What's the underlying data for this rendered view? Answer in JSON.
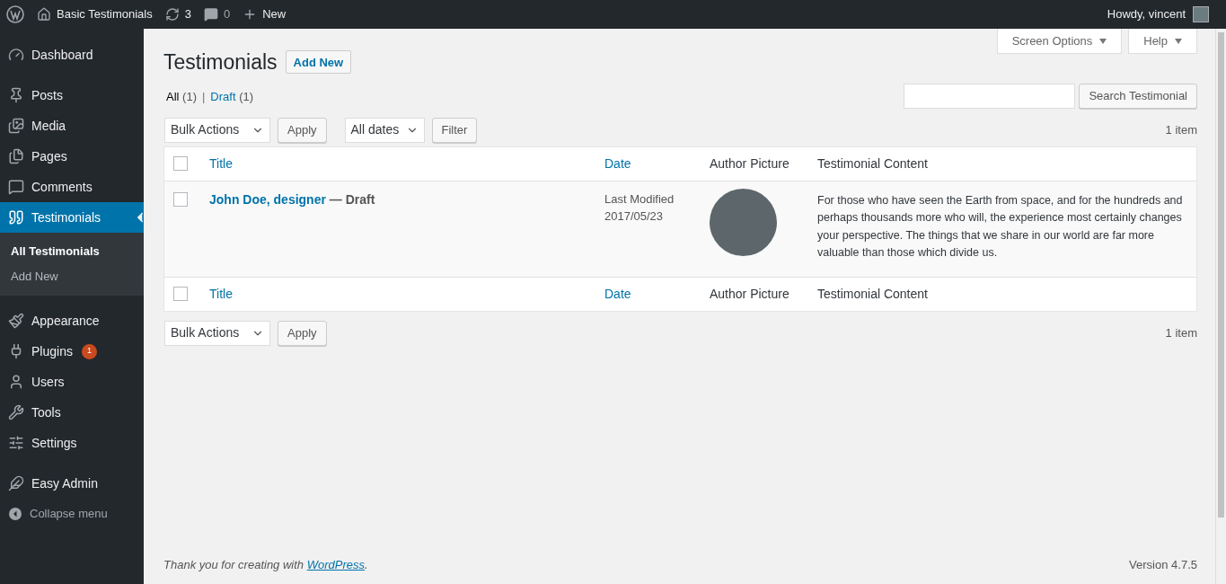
{
  "admin_bar": {
    "site_name": "Basic Testimonials",
    "updates": "3",
    "comments": "0",
    "new": "New",
    "greeting": "Howdy, vincent"
  },
  "sidebar": {
    "sections": [
      [
        {
          "label": "Dashboard",
          "selected": false
        }
      ],
      [
        {
          "label": "Posts",
          "selected": false
        },
        {
          "label": "Media",
          "selected": false
        },
        {
          "label": "Pages",
          "selected": false
        },
        {
          "label": "Comments",
          "selected": false
        },
        {
          "label": "Testimonials",
          "selected": true,
          "children": [
            {
              "label": "All Testimonials",
              "selected": true
            },
            {
              "label": "Add New",
              "selected": false
            }
          ]
        }
      ],
      [
        {
          "label": "Appearance",
          "selected": false
        },
        {
          "label": "Plugins",
          "selected": false,
          "badge": "1"
        },
        {
          "label": "Users",
          "selected": false
        },
        {
          "label": "Tools",
          "selected": false
        },
        {
          "label": "Settings",
          "selected": false
        }
      ],
      [
        {
          "label": "Easy Admin",
          "selected": false
        }
      ]
    ],
    "collapse": "Collapse menu"
  },
  "screen_tabs": [
    "Screen Options",
    "Help"
  ],
  "page": {
    "title": "Testimonials",
    "add_new": "Add New"
  },
  "views": [
    {
      "label": "All",
      "count": "(1)",
      "selected": true
    },
    {
      "label": "Draft",
      "count": "(1)",
      "selected": false
    }
  ],
  "views_separator": "|",
  "search": {
    "button": "Search Testimonial"
  },
  "top_nav": {
    "bulk": "Bulk Actions",
    "apply": "Apply",
    "dates": "All dates",
    "filter": "Filter",
    "count": "1 item"
  },
  "table": {
    "header": {
      "select_all_checked": false,
      "columns": [
        {
          "label": "Title",
          "sortable": true
        },
        {
          "label": "Date",
          "sortable": true
        },
        {
          "label": "Author Picture",
          "sortable": false
        },
        {
          "label": "Testimonial Content",
          "sortable": false
        }
      ]
    },
    "footer": {
      "select_all_checked": false,
      "columns": [
        {
          "label": "Title",
          "sortable": true
        },
        {
          "label": "Date",
          "sortable": true
        },
        {
          "label": "Author Picture",
          "sortable": false
        },
        {
          "label": "Testimonial Content",
          "sortable": false
        }
      ]
    },
    "rows": [
      {
        "checked": false,
        "title": "John Doe, designer",
        "state": "— Draft",
        "date_status": "Last Modified",
        "date": "2017/05/23",
        "content": "For those who have seen the Earth from space, and for the hundreds and perhaps thousands more who will, the experience most certainly changes your perspective. The things that we share in our world are far more valuable than those which divide us."
      }
    ]
  },
  "bottom_nav": {
    "bulk": "Bulk Actions",
    "apply": "Apply",
    "count": "1 item"
  },
  "footer": {
    "before": "Thank you for creating with ",
    "link": "WordPress",
    "after": ".",
    "version": "Version 4.7.5"
  }
}
